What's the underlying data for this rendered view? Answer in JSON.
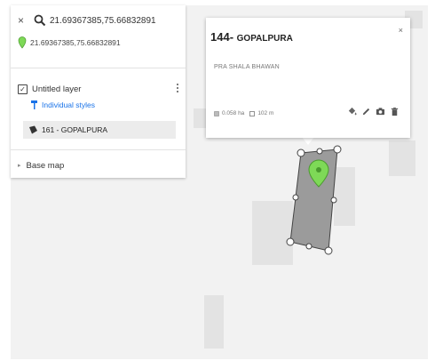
{
  "search": {
    "query": "21.69367385,75.66832891",
    "result_coords": "21.69367385,75.66832891"
  },
  "layer": {
    "name": "Untitled layer",
    "checked": true,
    "styles_link": "Individual styles",
    "feature_label": "161 - GOPALPURA"
  },
  "basemap": {
    "label": "Base map"
  },
  "popup": {
    "title_number": "144-",
    "title_name": "GOPALPURA",
    "description": "PRA SHALA BHAWAN",
    "area": "0.058 ha",
    "perimeter": "102 m",
    "close_symbol": "×"
  },
  "icons": {
    "search": "magnifier-icon",
    "clear": "close-icon",
    "pin": "map-pin-icon",
    "menu": "kebab-menu-icon",
    "style": "paint-roller-icon",
    "feature": "polygon-icon",
    "fill": "paint-bucket-icon",
    "edit": "pencil-icon",
    "camera": "camera-icon",
    "delete": "trash-icon"
  },
  "colors": {
    "pin": "#7ed957",
    "polygon_fill": "#8c8c8c",
    "link": "#1a73e8"
  }
}
